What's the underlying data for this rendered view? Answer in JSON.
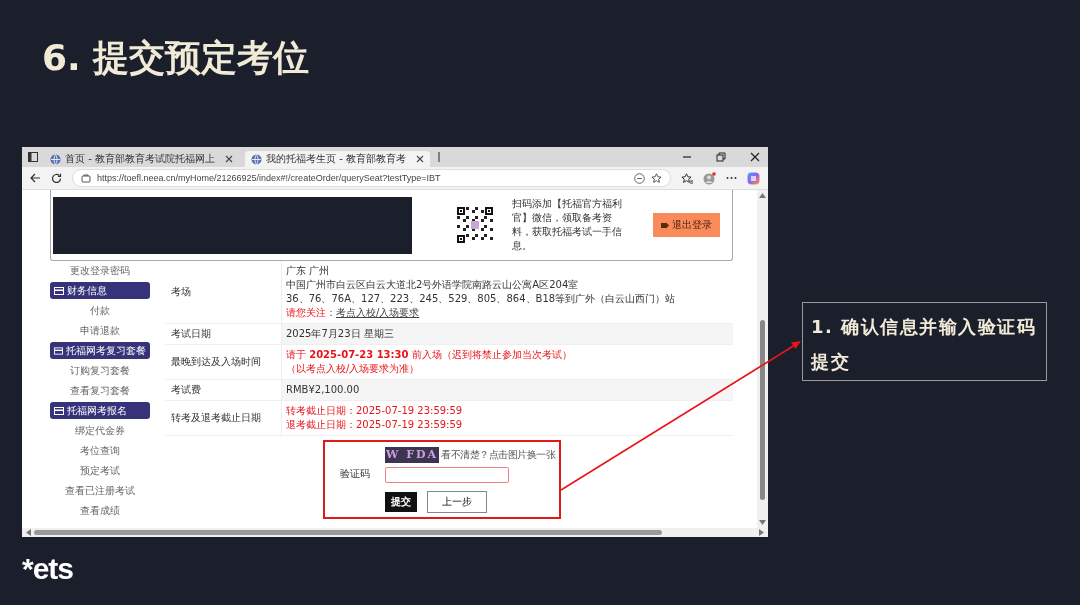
{
  "slide": {
    "title": "6. 提交预定考位",
    "callout": "1. 确认信息并输入验证码提交",
    "logo": "*ets"
  },
  "browser": {
    "tabs": [
      {
        "title": "首页 - 教育部教育考试院托福网上",
        "selected": false
      },
      {
        "title": "我的托福考生页 - 教育部教育考",
        "selected": true
      }
    ],
    "url": "https://toefl.neea.cn/myHome/21266925/index#!/createOrder/querySeat?testType=IBT"
  },
  "page": {
    "banner": {
      "promo_text": "扫码添加【托福官方福利官】微信，领取备考资料，获取托福考试一手信息。",
      "logout_button": "退出登录"
    },
    "sidebar": [
      {
        "label": "更改登录密码",
        "kind": "link"
      },
      {
        "label": "财务信息",
        "kind": "header"
      },
      {
        "label": "付款",
        "kind": "link"
      },
      {
        "label": "申请退款",
        "kind": "link"
      },
      {
        "label": "托福网考复习套餐",
        "kind": "header"
      },
      {
        "label": "订购复习套餐",
        "kind": "link"
      },
      {
        "label": "查看复习套餐",
        "kind": "link"
      },
      {
        "label": "托福网考报名",
        "kind": "header"
      },
      {
        "label": "绑定代金券",
        "kind": "link"
      },
      {
        "label": "考位查询",
        "kind": "link"
      },
      {
        "label": "预定考试",
        "kind": "link"
      },
      {
        "label": "查看已注册考试",
        "kind": "link"
      },
      {
        "label": "查看成绩",
        "kind": "link"
      }
    ],
    "details": [
      {
        "label": "考场",
        "lines": [
          {
            "kind": "plain",
            "text": "广东 广州"
          },
          {
            "kind": "plain",
            "text": "中国广州市白云区白云大道北2号外语学院南路云山公寓A区204室"
          },
          {
            "kind": "plain",
            "text": "36、76、76A、127、223、245、529、805、864、B18等到广外（白云山西门）站"
          },
          {
            "kind": "notice",
            "text": "请您关注：",
            "link": "考点入校/入场要求"
          }
        ]
      },
      {
        "label": "考试日期",
        "lines": [
          {
            "kind": "plain",
            "text": "2025年7月23日 星期三"
          }
        ]
      },
      {
        "label": "最晚到达及入场时间",
        "lines": [
          {
            "kind": "alert",
            "text": "请于 **2025-07-23 13:30** 前入场（迟到将禁止参加当次考试）"
          },
          {
            "kind": "alert",
            "text": "（以考点入校/入场要求为准）"
          }
        ]
      },
      {
        "label": "考试费",
        "lines": [
          {
            "kind": "plain",
            "text": "RMB¥2,100.00"
          }
        ]
      },
      {
        "label": "转考及退考截止日期",
        "lines": [
          {
            "kind": "alert",
            "text": "转考截止日期：2025-07-19 23:59:59"
          },
          {
            "kind": "alert",
            "text": "退考截止日期：2025-07-19 23:59:59"
          }
        ]
      }
    ],
    "captcha": {
      "image_text": "W FDA",
      "hint": "看不清楚？点击图片换一张",
      "label": "验证码",
      "submit_button": "提交",
      "back_button": "上一步"
    }
  }
}
